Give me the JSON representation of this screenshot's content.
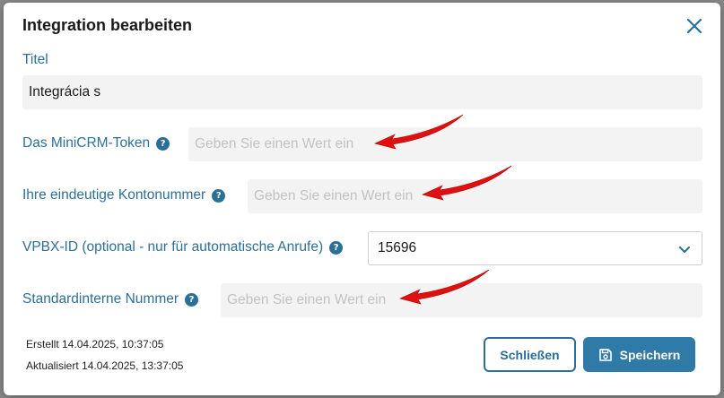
{
  "dialog": {
    "title": "Integration bearbeiten",
    "fields": {
      "titel": {
        "label": "Titel",
        "value": "Integrácia s"
      },
      "token": {
        "label": "Das MiniCRM-Token",
        "placeholder": "Geben Sie einen Wert ein",
        "help": "?"
      },
      "konto": {
        "label": "Ihre eindeutige Kontonummer",
        "placeholder": "Geben Sie einen Wert ein",
        "help": "?"
      },
      "vpbx": {
        "label": "VPBX-ID (optional - nur für automatische Anrufe)",
        "value": "15696",
        "help": "?"
      },
      "intern": {
        "label": "Standardinterne Nummer",
        "placeholder": "Geben Sie einen Wert ein",
        "help": "?"
      }
    },
    "meta": {
      "created": "Erstellt 14.04.2025, 10:37:05",
      "updated": "Aktualisiert 14.04.2025, 13:37:05"
    },
    "buttons": {
      "close": "Schließen",
      "save": "Speichern"
    }
  },
  "colors": {
    "accent": "#2f7aa6",
    "label": "#2e6f96",
    "annotation_arrow": "#e01010"
  }
}
